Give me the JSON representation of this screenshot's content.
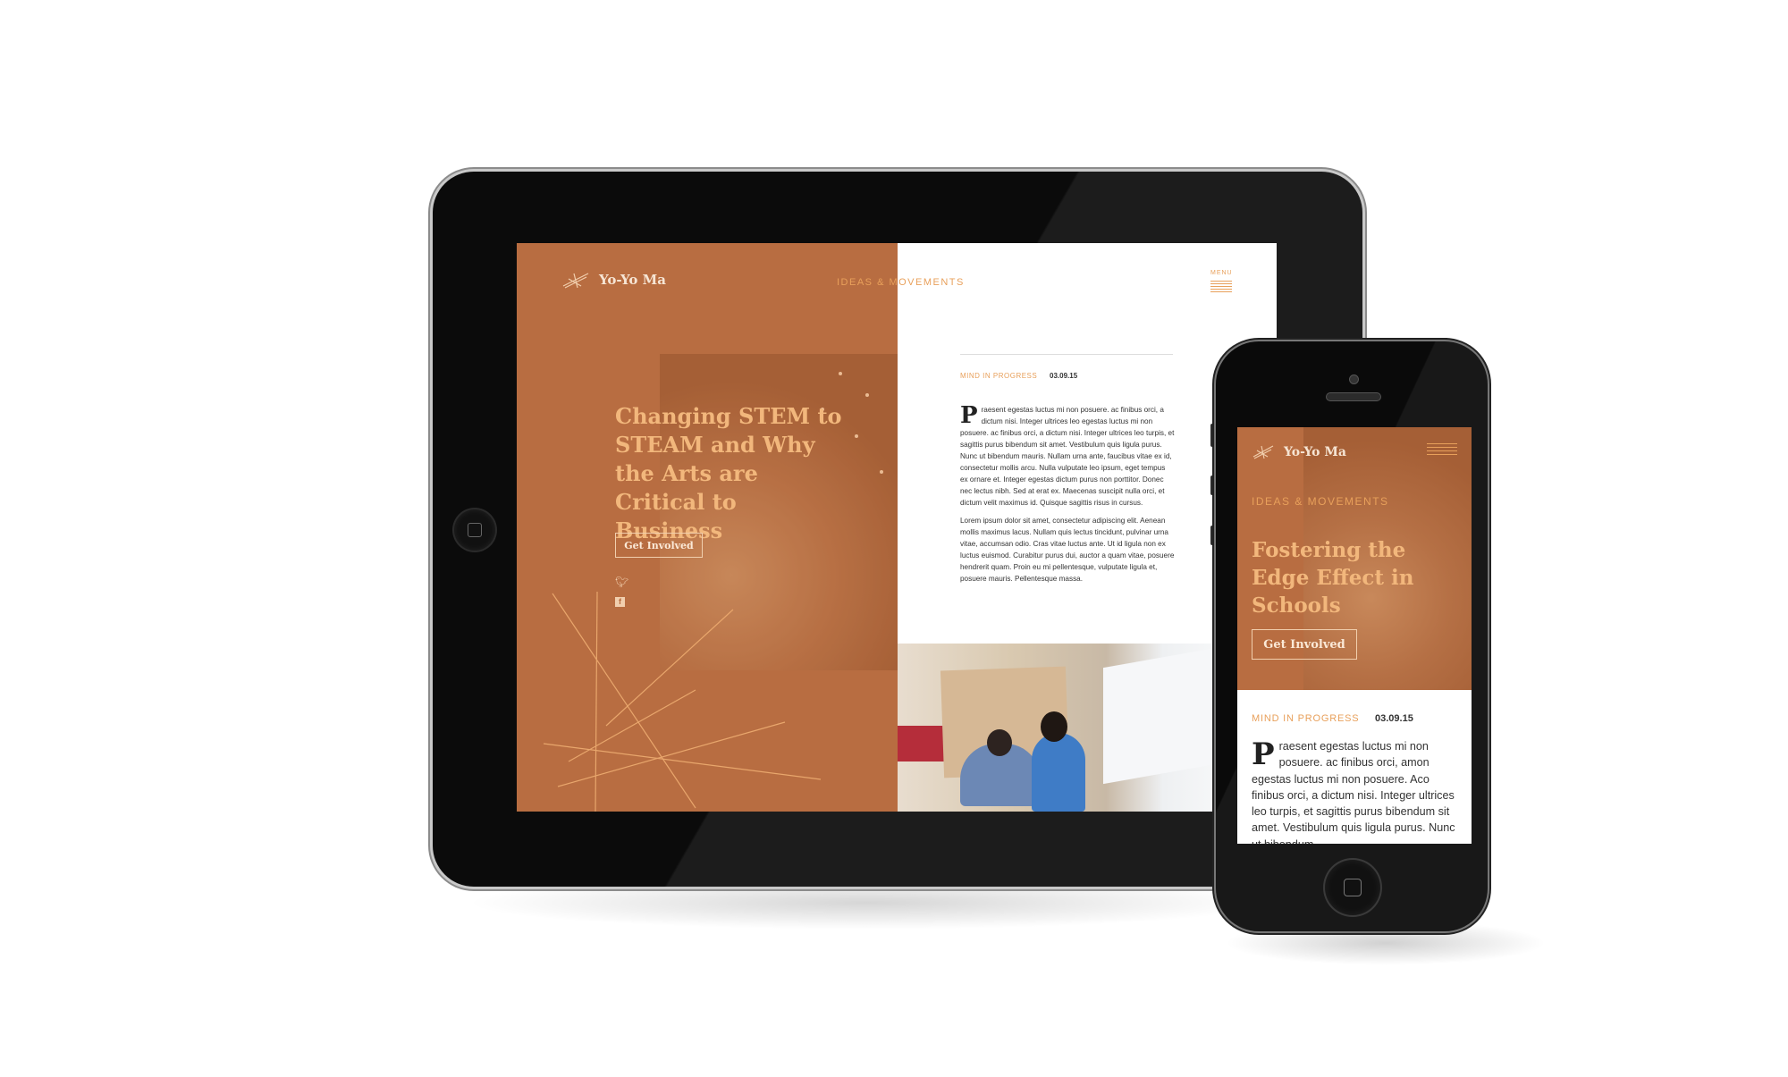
{
  "tablet": {
    "site": {
      "logo_text": "Yo-Yo Ma",
      "nav_label": "IDEAS & MOVEMENTS",
      "menu_label": "MENU"
    },
    "hero": {
      "headline": "Changing STEM to STEAM and Why the Arts are Critical to Business",
      "cta_label": "Get Involved",
      "social": [
        "twitter-icon",
        "facebook-icon"
      ]
    },
    "article": {
      "category": "MIND IN PROGRESS",
      "date": "03.09.15",
      "dropcap": "P",
      "para1": "raesent egestas luctus mi non posuere.   ac finibus orci, a dictum nisi. Integer ultrices leo egestas luctus mi non posuere.   ac finibus orci, a dictum nisi. Integer ultrices leo turpis, et sagittis purus bibendum sit amet. Vestibulum quis ligula purus. Nunc ut bibendum mauris. Nullam urna ante, faucibus vitae ex id, consectetur mollis arcu. Nulla vulputate leo ipsum, eget tempus ex ornare et. Integer egestas dictum purus non porttitor. Donec nec lectus nibh. Sed at erat ex. Maecenas suscipit nulla orci, et dictum velit maximus id. Quisque sagittis risus in cursus.",
      "para2": "Lorem ipsum dolor sit amet, consectetur adipiscing elit. Aenean mollis maximus lacus. Nullam quis lectus tincidunt, pulvinar urna vitae, accumsan odio. Cras vitae luctus ante. Ut id ligula non ex luctus euismod. Curabitur purus dui, auctor a quam vitae, posuere hendrerit quam. Proin eu mi pellentesque, vulputate ligula et, posuere mauris. Pellentesque massa."
    }
  },
  "phone": {
    "site": {
      "logo_text": "Yo-Yo Ma",
      "nav_label": "IDEAS & MOVEMENTS"
    },
    "hero": {
      "headline": "Fostering the Edge Effect in Schools",
      "cta_label": "Get Involved"
    },
    "article": {
      "category": "MIND IN PROGRESS",
      "date": "03.09.15",
      "dropcap": "P",
      "para1": "raesent egestas luctus mi non posuere.   ac finibus orci, amon egestas luctus mi non posuere. Aco finibus orci, a dictum nisi. Integer ultrices leo turpis, et sagittis purus bibendum sit amet. Vestibulum quis ligula purus. Nunc ut bibendum"
    }
  },
  "colors": {
    "brand_orange": "#b86d41",
    "accent": "#e8a05b",
    "headline": "#f2b77c",
    "device_black": "#0b0b0b"
  }
}
